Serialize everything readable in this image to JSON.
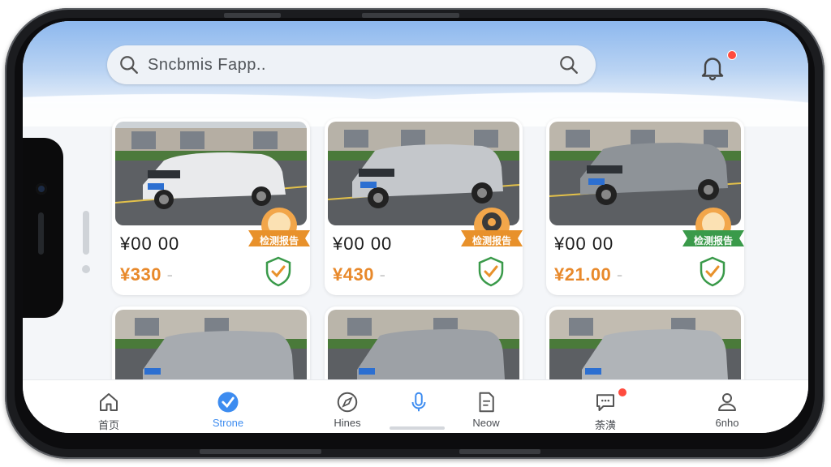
{
  "search": {
    "placeholder": "Sncbmis Fapp.."
  },
  "listings": [
    {
      "price_line": "¥00 00",
      "price": "¥330",
      "suffix": "-",
      "badge_label": "检测报告",
      "car_color": "#e9eaec"
    },
    {
      "price_line": "¥00 00",
      "price": "¥430",
      "suffix": "-",
      "badge_label": "检测报告",
      "car_color": "#c4c7cb"
    },
    {
      "price_line": "¥00 00",
      "price": "¥21.00",
      "suffix": "-",
      "badge_label": "检测报告",
      "car_color": "#8e9398"
    },
    {
      "car_color": "#a7abb0"
    },
    {
      "car_color": "#9da1a6"
    },
    {
      "car_color": "#b0b4b8"
    }
  ],
  "tabbar": {
    "items": [
      {
        "label": "首页",
        "icon": "home-icon"
      },
      {
        "label": "Strone",
        "icon": "check-circle-icon",
        "active": true
      },
      {
        "label": "Hines",
        "icon": "compass-icon"
      },
      {
        "label": "",
        "icon": "microphone-icon"
      },
      {
        "label": "Neow",
        "icon": "document-icon"
      },
      {
        "label": "荼潢",
        "icon": "chat-icon"
      },
      {
        "label": "6nho",
        "icon": "user-icon"
      }
    ]
  },
  "colors": {
    "accent": "#3d8cf0",
    "price": "#e8892b",
    "badge": "#e8912b",
    "badge_green": "#3a9a4a",
    "shield": "#3a9a4a",
    "notification": "#ff4b3e"
  }
}
